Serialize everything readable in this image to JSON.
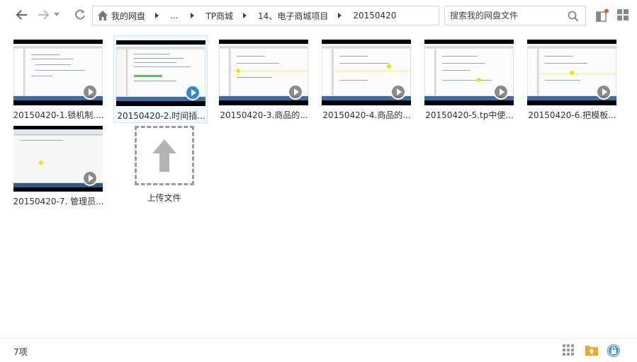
{
  "breadcrumb": [
    "我的网盘",
    "...",
    "TP商城",
    "14、电子商城项目",
    "20150420"
  ],
  "search": {
    "placeholder": "搜索我的网盘文件",
    "value": ""
  },
  "files": [
    {
      "label": "20150420-1.锁机制...."
    },
    {
      "label": "20150420-2.时间插...",
      "selected": true
    },
    {
      "label": "20150420-3.商品的..."
    },
    {
      "label": "20150420-4.商品的..."
    },
    {
      "label": "20150420-5.tp中使..."
    },
    {
      "label": "20150420-6.把模板..."
    },
    {
      "label": "20150420-7. 管理员..."
    }
  ],
  "upload": {
    "label": "上传文件"
  },
  "status": {
    "count": "7项"
  },
  "icons": {
    "back": "arrow-left-icon",
    "forward": "arrow-right-icon",
    "history": "chevron-down-icon",
    "refresh": "refresh-icon",
    "home": "home-icon",
    "search": "search-icon",
    "notify": "window-notify-icon",
    "grid": "grid-view-icon",
    "upload_folder": "upload-folder-icon",
    "lock": "lock-icon"
  },
  "colors": {
    "accent": "#2f8ad4",
    "notify_dot": "#f05a28",
    "upload_folder": "#f5a623"
  }
}
